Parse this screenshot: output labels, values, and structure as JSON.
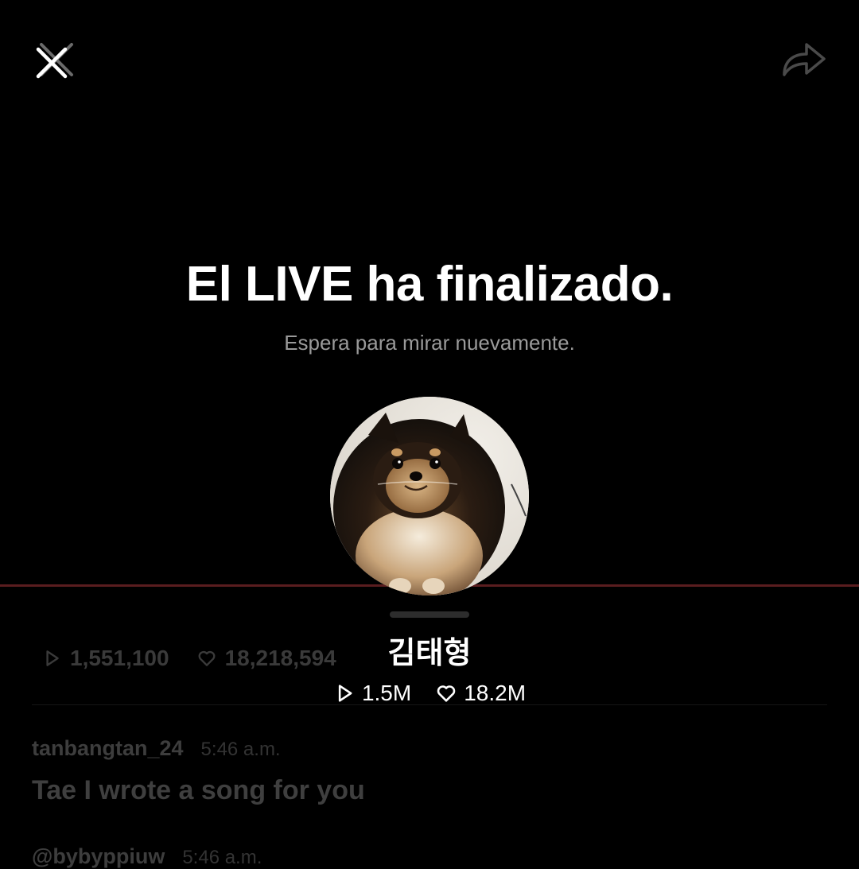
{
  "header": {
    "close_icon": "close-icon",
    "share_icon": "share-arrow-icon"
  },
  "main": {
    "title": "El LIVE ha finalizado.",
    "subtitle": "Espera para mirar nuevamente."
  },
  "artist": {
    "name": "김태형",
    "views_short": "1.5M",
    "likes_short": "18.2M",
    "avatar_icon": "pomeranian-dog-avatar"
  },
  "background": {
    "views": "1,551,100",
    "likes": "18,218,594",
    "comments": [
      {
        "user": "tanbangtan_24",
        "time": "5:46 a.m.",
        "message": "Tae I wrote a song for you"
      },
      {
        "user": "@bybyppiuw",
        "time": "5:46 a.m.",
        "message": ""
      }
    ]
  },
  "colors": {
    "background": "#000000",
    "accent_divider": "#5a1d1f",
    "subtitle": "#9a9a9a"
  }
}
